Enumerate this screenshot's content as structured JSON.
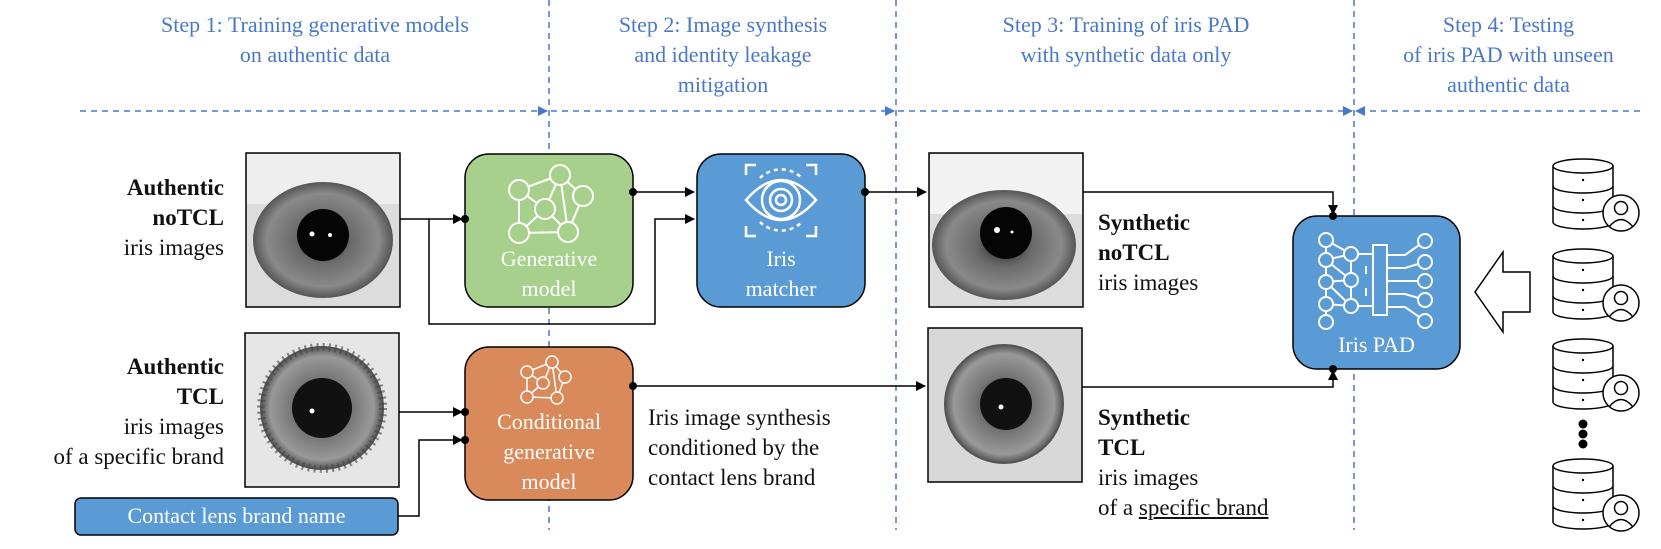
{
  "steps": [
    {
      "line1": "Step 1: Training generative models",
      "line2": "on authentic data",
      "line3": ""
    },
    {
      "line1": "Step 2: Image synthesis",
      "line2": "and identity leakage",
      "line3": "mitigation"
    },
    {
      "line1": "Step 3: Training of iris PAD",
      "line2": "with synthetic data only",
      "line3": ""
    },
    {
      "line1": "Step 4: Testing",
      "line2": "of iris PAD with unseen",
      "line3": "authentic data"
    }
  ],
  "inputs": {
    "authentic_notcl": {
      "bold1": "Authentic",
      "bold2": "noTCL",
      "line3": "iris images",
      "line4": ""
    },
    "authentic_tcl": {
      "bold1": "Authentic",
      "bold2": "TCL",
      "line3": "iris images",
      "line4": "of a specific brand"
    },
    "brand_name": "Contact lens brand name"
  },
  "blocks": {
    "generative_model": {
      "line1": "Generative",
      "line2": "model",
      "icon": "network-graph-icon",
      "color": "#a8d08d"
    },
    "iris_matcher": {
      "line1": "Iris",
      "line2": "matcher",
      "icon": "eye-scan-icon",
      "color": "#5b9bd5"
    },
    "conditional_model": {
      "line1": "Conditional",
      "line2": "generative",
      "line3": "model",
      "icon": "network-graph-icon",
      "color": "#d9895a"
    },
    "iris_pad": {
      "line1": "Iris PAD",
      "icon": "neural-network-icon",
      "color": "#5b9bd5"
    }
  },
  "annotation": {
    "line1": "Iris image synthesis",
    "line2": "conditioned by the",
    "line3": "contact lens brand"
  },
  "outputs": {
    "synthetic_notcl": {
      "bold1": "Synthetic",
      "bold2": "noTCL",
      "line3": "iris images"
    },
    "synthetic_tcl": {
      "bold1": "Synthetic",
      "bold2": "TCL",
      "line3": "iris images",
      "line4_prefix": "of a ",
      "line4_underlined": "specific brand"
    }
  },
  "test_databases": {
    "icon": "database-user-icon",
    "count_shown": 4,
    "ellipsis": "vertical-dots"
  },
  "colors": {
    "step_blue": "#4a78c8",
    "green": "#a8d08d",
    "blue": "#5b9bd5",
    "orange": "#d9895a"
  }
}
